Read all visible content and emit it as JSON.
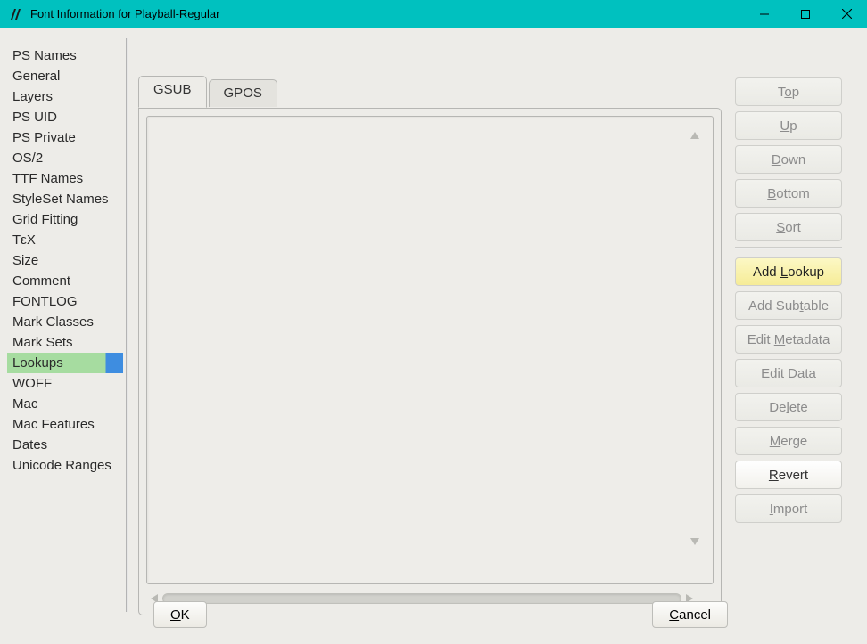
{
  "window": {
    "title": "Font Information for Playball-Regular"
  },
  "sidebar": {
    "items": [
      {
        "label": "PS Names"
      },
      {
        "label": "General"
      },
      {
        "label": "Layers"
      },
      {
        "label": "PS UID"
      },
      {
        "label": "PS Private"
      },
      {
        "label": "OS/2"
      },
      {
        "label": "TTF Names"
      },
      {
        "label": "StyleSet Names"
      },
      {
        "label": "Grid Fitting"
      },
      {
        "label": "TεX"
      },
      {
        "label": "Size"
      },
      {
        "label": "Comment"
      },
      {
        "label": "FONTLOG"
      },
      {
        "label": "Mark Classes"
      },
      {
        "label": "Mark Sets"
      },
      {
        "label": "Lookups"
      },
      {
        "label": "WOFF"
      },
      {
        "label": "Mac"
      },
      {
        "label": "Mac Features"
      },
      {
        "label": "Dates"
      },
      {
        "label": "Unicode Ranges"
      }
    ],
    "selected_index": 15
  },
  "tabs": {
    "gsub": "GSUB",
    "gpos": "GPOS",
    "active": "gsub"
  },
  "buttons": {
    "top_pre": "T",
    "top_mn": "o",
    "top_post": "p",
    "up_pre": "",
    "up_mn": "U",
    "up_post": "p",
    "down_pre": "",
    "down_mn": "D",
    "down_post": "own",
    "bottom_pre": "",
    "bottom_mn": "B",
    "bottom_post": "ottom",
    "sort_pre": "",
    "sort_mn": "S",
    "sort_post": "ort",
    "addlk_pre": "Add ",
    "addlk_mn": "L",
    "addlk_post": "ookup",
    "addsub_pre": "Add Sub",
    "addsub_mn": "t",
    "addsub_post": "able",
    "editmeta_pre": "Edit ",
    "editmeta_mn": "M",
    "editmeta_post": "etadata",
    "editdata_pre": "",
    "editdata_mn": "E",
    "editdata_post": "dit Data",
    "delete_pre": "De",
    "delete_mn": "l",
    "delete_post": "ete",
    "merge_pre": "",
    "merge_mn": "M",
    "merge_post": "erge",
    "revert_pre": "",
    "revert_mn": "R",
    "revert_post": "evert",
    "import_pre": "",
    "import_mn": "I",
    "import_post": "mport"
  },
  "footer": {
    "ok_pre": "",
    "ok_mn": "O",
    "ok_post": "K",
    "cancel_pre": "",
    "cancel_mn": "C",
    "cancel_post": "ancel"
  }
}
